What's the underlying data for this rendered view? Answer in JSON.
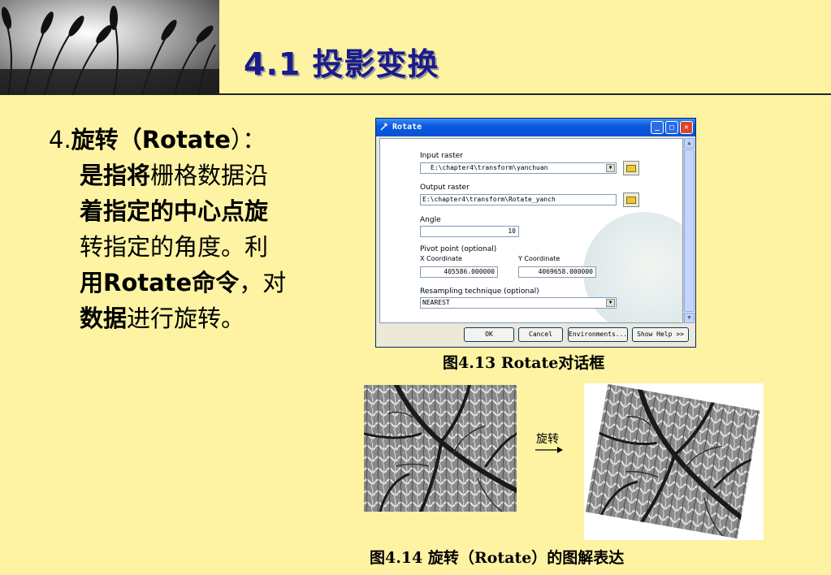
{
  "slide": {
    "title": "4.1 投影变换",
    "body": {
      "part1": "4.",
      "part2": "旋转（",
      "part3": "Rotate",
      "part4": "）：",
      "line2_bold": "是指将",
      "line2_rest": "栅格数据沿",
      "line3_bold": "着指定的中心点旋",
      "line4": "转指定的角度。利",
      "line5_bold": "用Rotate命令",
      "line5_rest": "，对",
      "line6_bold": "数据",
      "line6_rest": "进行旋转。"
    },
    "caption1": "图4.13 Rotate对话框",
    "caption2": "图4.14  旋转（Rotate）的图解表达",
    "arrow_label": "旋转"
  },
  "dialog": {
    "title": "Rotate",
    "input_raster_label": "Input raster",
    "input_raster_value": "E:\\chapter4\\transform\\yanchuan",
    "output_raster_label": "Output raster",
    "output_raster_value": "E:\\chapter4\\transform\\Rotate_yanch",
    "angle_label": "Angle",
    "angle_value": "10",
    "pivot_label": "Pivot point (optional)",
    "x_label": "X Coordinate",
    "y_label": "Y Coordinate",
    "x_value": "405586.000000",
    "y_value": "4069658.000000",
    "resample_label": "Resampling technique (optional)",
    "resample_value": "NEAREST",
    "ok": "OK",
    "cancel": "Cancel",
    "environments": "Environments...",
    "show_help": "Show Help >>"
  },
  "colors": {
    "background": "#fdf3a2",
    "title": "#1b1b8a",
    "titlebar": "#0a5ae0"
  }
}
